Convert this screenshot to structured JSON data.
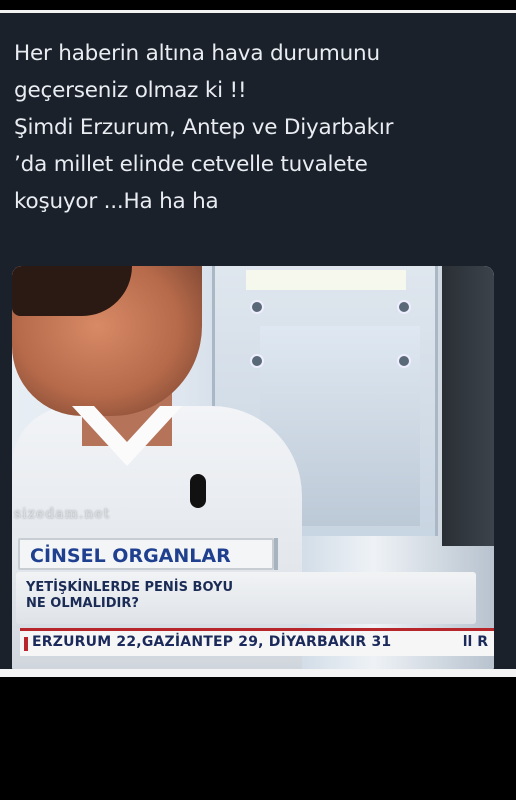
{
  "post": {
    "lines": [
      "Her haberin altına hava durumunu",
      "geçerseniz olmaz ki !!",
      "Şimdi Erzurum, Antep ve Diyarbakır",
      "’da millet elinde cetvelle tuvalete",
      "koşuyor ...Ha ha ha"
    ]
  },
  "broadcast": {
    "watermark": "sizedam.net",
    "topic": "CİNSEL ORGANLAR",
    "question_lines": [
      "YETİŞKİNLERDE PENİS BOYU",
      "NE OLMALIDIR?"
    ],
    "ticker": "ERZURUM 22,GAZİANTEP 29, DİYARBAKIR 31",
    "ticker_right": "ll R"
  }
}
